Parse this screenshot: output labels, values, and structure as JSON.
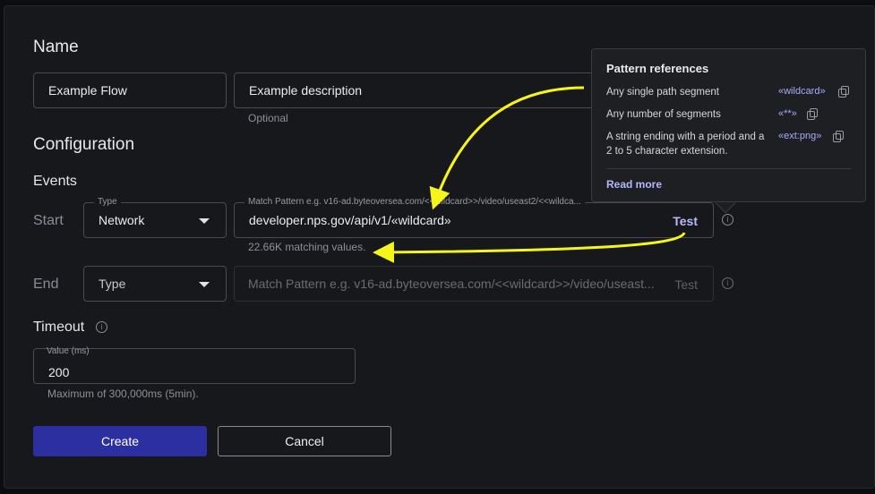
{
  "form": {
    "name_heading": "Name",
    "name_value": "Example Flow",
    "description_value": "Example description",
    "description_helper": "Optional",
    "config_heading": "Configuration",
    "events_heading": "Events",
    "start": {
      "label": "Start",
      "type_label": "Type",
      "type_value": "Network",
      "pattern_label": "Match Pattern e.g. v16-ad.byteoversea.com/<<wildcard>>/video/useast2/<<wildca...",
      "pattern_value": "developer.nps.gov/api/v1/«wildcard»",
      "test_label": "Test",
      "matching_helper": "22.66K matching values."
    },
    "end": {
      "label": "End",
      "type_placeholder": "Type",
      "pattern_placeholder": "Match Pattern e.g. v16-ad.byteoversea.com/<<wildcard>>/video/useast...",
      "test_label": "Test"
    },
    "timeout": {
      "heading": "Timeout",
      "value_label": "Value (ms)",
      "value": "200",
      "helper": "Maximum of 300,000ms (5min)."
    },
    "create_label": "Create",
    "cancel_label": "Cancel"
  },
  "popover": {
    "title": "Pattern references",
    "rows": [
      {
        "description": "Any single path segment",
        "code": "«wildcard»"
      },
      {
        "description": "Any number of segments",
        "code": "«**»"
      },
      {
        "description": "A string ending with a period and a 2 to 5 character extension.",
        "code": "«ext:png»"
      }
    ],
    "read_more": "Read more"
  },
  "icons": {
    "info": "info-icon",
    "copy": "copy-icon",
    "dropdown": "caret-down-icon"
  },
  "colors": {
    "background": "#17181b",
    "primary_button": "#2b2f9f",
    "link": "#b4b6ff",
    "annotation_arrow": "#f5f51c"
  }
}
